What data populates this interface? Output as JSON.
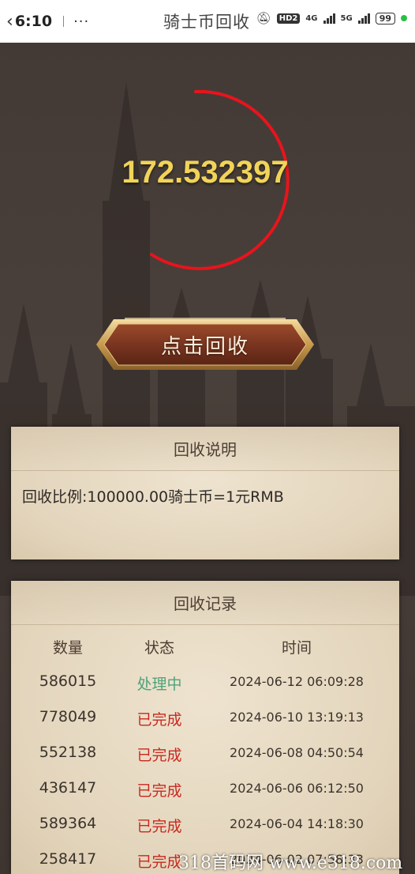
{
  "status_bar": {
    "time": "6:10",
    "more": "···",
    "signal_4g": "4G",
    "signal_5g": "5G",
    "hd": "HD2",
    "battery": "99"
  },
  "app": {
    "title": "骑士币回收"
  },
  "balance": {
    "amount": "172.532397"
  },
  "recycle_button": {
    "label": "点击回收"
  },
  "description": {
    "title": "回收说明",
    "text": "回收比例:100000.00骑士币=1元RMB"
  },
  "records": {
    "title": "回收记录",
    "columns": [
      "数量",
      "状态",
      "时间"
    ],
    "rows": [
      {
        "quantity": "586015",
        "status": "处理中",
        "time": "2024-06-12 06:09:28"
      },
      {
        "quantity": "778049",
        "status": "已完成",
        "time": "2024-06-10 13:19:13"
      },
      {
        "quantity": "552138",
        "status": "已完成",
        "time": "2024-06-08 04:50:54"
      },
      {
        "quantity": "436147",
        "status": "已完成",
        "time": "2024-06-06 06:12:50"
      },
      {
        "quantity": "589364",
        "status": "已完成",
        "time": "2024-06-04 14:18:30"
      },
      {
        "quantity": "258417",
        "status": "已完成",
        "time": "2024-06-02 07:58:33"
      }
    ]
  },
  "colors": {
    "amount": "#f1d458",
    "ring": "#e8141c",
    "processing": "#4fa37a",
    "done": "#c8281f"
  },
  "watermark": "318首码网  www.e318.com"
}
